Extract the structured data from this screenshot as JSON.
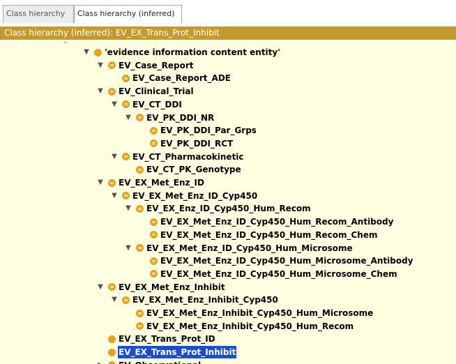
{
  "tabs": [
    {
      "label": "Class hierarchy",
      "active": false
    },
    {
      "label": "Class hierarchy (inferred)",
      "active": true
    }
  ],
  "panel": {
    "title": "Class hierarchy (inferred): EV_EX_Trans_Prot_Inhibit"
  },
  "colors": {
    "title_bar": "#c49a2e",
    "tree_background": "#ffffe1",
    "class_icon": "#e0a41e",
    "selection": "#1e4dcc"
  },
  "tree": {
    "rows": [
      {
        "label": "'evidence information content entity'",
        "expander": "expanded",
        "icon": "class-icon"
      },
      {
        "label": "EV_Case_Report",
        "expander": "expanded",
        "icon": "defined-class-icon"
      },
      {
        "label": "EV_Case_Report_ADE",
        "expander": "none",
        "icon": "defined-class-icon"
      },
      {
        "label": "EV_Clinical_Trial",
        "expander": "expanded",
        "icon": "defined-class-icon"
      },
      {
        "label": "EV_CT_DDI",
        "expander": "expanded",
        "icon": "defined-class-icon"
      },
      {
        "label": "EV_PK_DDI_NR",
        "expander": "expanded",
        "icon": "defined-class-icon"
      },
      {
        "label": "EV_PK_DDI_Par_Grps",
        "expander": "none",
        "icon": "defined-class-icon"
      },
      {
        "label": "EV_PK_DDI_RCT",
        "expander": "none",
        "icon": "defined-class-icon"
      },
      {
        "label": "EV_CT_Pharmacokinetic",
        "expander": "expanded",
        "icon": "defined-class-icon"
      },
      {
        "label": "EV_CT_PK_Genotype",
        "expander": "none",
        "icon": "defined-class-icon"
      },
      {
        "label": "EV_EX_Met_Enz_ID",
        "expander": "expanded",
        "icon": "defined-class-icon"
      },
      {
        "label": "EV_EX_Met_Enz_ID_Cyp450",
        "expander": "expanded",
        "icon": "defined-class-icon"
      },
      {
        "label": "EV_EX_Enz_ID_Cyp450_Hum_Recom",
        "expander": "expanded",
        "icon": "defined-class-icon"
      },
      {
        "label": "EV_EX_Met_Enz_ID_Cyp450_Hum_Recom_Antibody",
        "expander": "none",
        "icon": "defined-class-icon"
      },
      {
        "label": "EV_EX_Met_Enz_ID_Cyp450_Hum_Recom_Chem",
        "expander": "none",
        "icon": "defined-class-icon"
      },
      {
        "label": "EV_EX_Met_Enz_ID_Cyp450_Hum_Microsome",
        "expander": "expanded",
        "icon": "defined-class-icon"
      },
      {
        "label": "EV_EX_Met_Enz_ID_Cyp450_Hum_Microsome_Antibody",
        "expander": "none",
        "icon": "defined-class-icon"
      },
      {
        "label": "EV_EX_Met_Enz_ID_Cyp450_Hum_Microsome_Chem",
        "expander": "none",
        "icon": "defined-class-icon"
      },
      {
        "label": "EV_EX_Met_Enz_Inhibit",
        "expander": "expanded",
        "icon": "defined-class-icon"
      },
      {
        "label": "EV_EX_Met_Enz_Inhibit_Cyp450",
        "expander": "expanded",
        "icon": "defined-class-icon"
      },
      {
        "label": "EV_EX_Met_Enz_Inhibit_Cyp450_Hum_Microsome",
        "expander": "none",
        "icon": "defined-class-icon"
      },
      {
        "label": "EV_EX_Met_Enz_Inhibit_Cyp450_Hum_Recom",
        "expander": "none",
        "icon": "defined-class-icon"
      },
      {
        "label": "EV_EX_Trans_Prot_ID",
        "expander": "none",
        "icon": "class-icon"
      },
      {
        "label": "EV_EX_Trans_Prot_Inhibit",
        "expander": "none",
        "icon": "class-icon",
        "selected": true
      },
      {
        "label": "EV_Observational",
        "expander": "collapsed",
        "icon": "defined-class-icon"
      }
    ]
  }
}
